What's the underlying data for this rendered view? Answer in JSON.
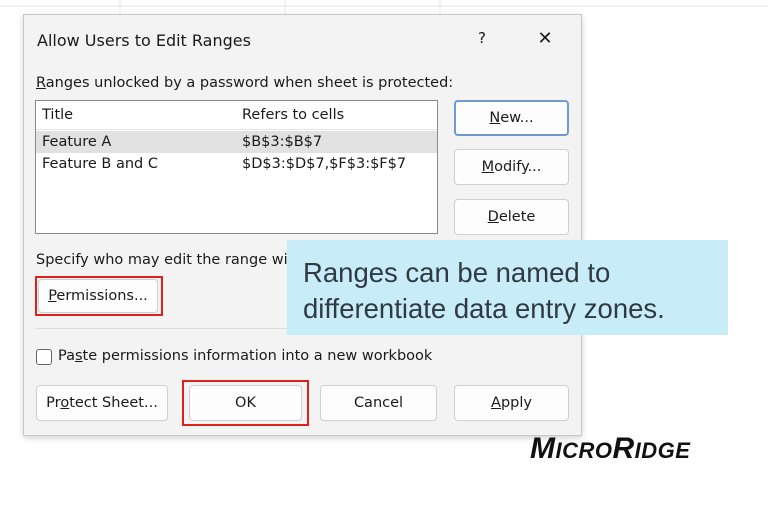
{
  "dialog": {
    "title": "Allow Users to Edit Ranges",
    "help_label": "?",
    "close_label": "✕",
    "ranges_label_accel": "R",
    "ranges_label_rest": "anges unlocked by a password when sheet is protected:",
    "columns": [
      "Title",
      "Refers to cells"
    ],
    "rows": [
      {
        "title": "Feature A",
        "refers": "$B$3:$B$7"
      },
      {
        "title": "Feature B and C",
        "refers": "$D$3:$D$7,$F$3:$F$7"
      }
    ],
    "new_button": {
      "accel": "N",
      "rest": "ew..."
    },
    "modify_button": {
      "accel": "M",
      "rest": "odify..."
    },
    "delete_button": {
      "accel": "D",
      "rest": "elete"
    },
    "specify_label": "Specify who may edit the range wit",
    "permissions_button": {
      "accel": "P",
      "rest": "ermissions..."
    },
    "paste_checkbox": {
      "pre": "Pa",
      "accel": "s",
      "post": "te permissions information into a new workbook",
      "checked": false
    },
    "protect_sheet_button": {
      "pre": "Pr",
      "accel": "o",
      "post": "tect Sheet..."
    },
    "ok_button": "OK",
    "cancel_button": "Cancel",
    "apply_button": {
      "accel": "A",
      "rest": "pply"
    }
  },
  "callout": {
    "line1": "Ranges can be named to",
    "line2": "differentiate data entry zones."
  },
  "logo": {
    "m": "M",
    "icro": "ICRO",
    "r": "R",
    "idge": "IDGE"
  },
  "colors": {
    "highlight_box": "#e0201c",
    "callout_bg": "#c9ecf9",
    "default_button_border": "#6f9bd1"
  }
}
